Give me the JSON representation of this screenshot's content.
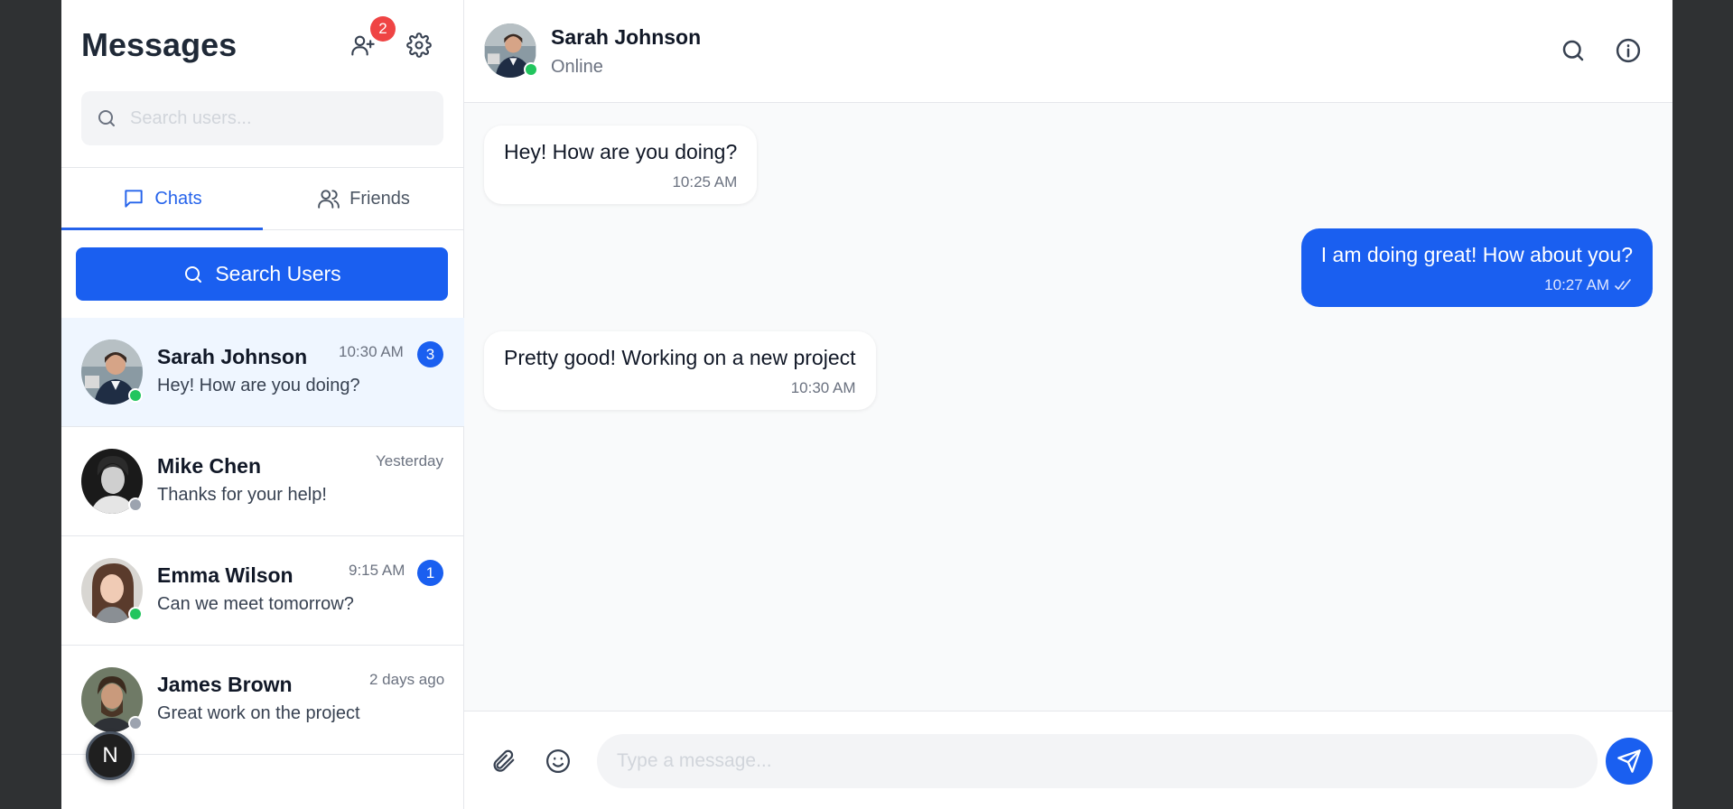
{
  "sidebar": {
    "title": "Messages",
    "friend_requests_badge": "2",
    "search_placeholder": "Search users...",
    "tabs": [
      {
        "label": "Chats",
        "active": true
      },
      {
        "label": "Friends",
        "active": false
      }
    ],
    "search_users_label": "Search Users",
    "chats": [
      {
        "name": "Sarah Johnson",
        "time": "10:30 AM",
        "preview": "Hey! How are you doing?",
        "unread": "3",
        "status": "online",
        "active": true
      },
      {
        "name": "Mike Chen",
        "time": "Yesterday",
        "preview": "Thanks for your help!",
        "unread": "",
        "status": "offline",
        "active": false
      },
      {
        "name": "Emma Wilson",
        "time": "9:15 AM",
        "preview": "Can we meet tomorrow?",
        "unread": "1",
        "status": "online",
        "active": false
      },
      {
        "name": "James Brown",
        "time": "2 days ago",
        "preview": "Great work on the project",
        "unread": "",
        "status": "offline",
        "active": false
      }
    ],
    "fab_label": "N"
  },
  "conversation": {
    "contact_name": "Sarah Johnson",
    "contact_status": "Online",
    "messages": [
      {
        "text": "Hey! How are you doing?",
        "time": "10:25 AM",
        "direction": "in"
      },
      {
        "text": "I am doing great! How about you?",
        "time": "10:27 AM",
        "direction": "out",
        "read": true
      },
      {
        "text": "Pretty good! Working on a new project",
        "time": "10:30 AM",
        "direction": "in"
      }
    ],
    "composer_placeholder": "Type a message..."
  },
  "colors": {
    "accent": "#1a5ff0",
    "online": "#22c55e",
    "offline": "#9ca3af",
    "badge_red": "#ef4444"
  },
  "icons": [
    "add-user-icon",
    "gear-icon",
    "search-icon",
    "chat-bubble-icon",
    "users-icon",
    "info-icon",
    "paperclip-icon",
    "smiley-icon",
    "send-icon",
    "double-check-icon"
  ]
}
